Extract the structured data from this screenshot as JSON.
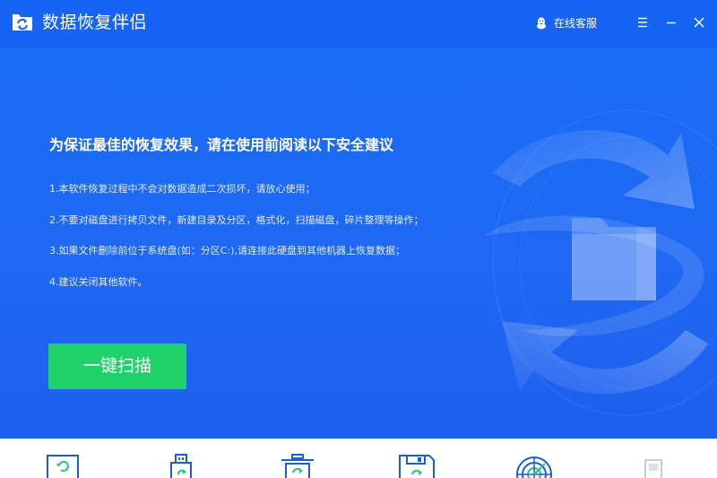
{
  "app": {
    "title": "数据恢复伴侣",
    "logo_icon": "recovery-logo-icon"
  },
  "titlebar": {
    "service_label": "在线客服",
    "service_icon": "qq-penguin-icon",
    "menu_icon": "hamburger-menu-icon",
    "minimize_icon": "minimize-icon",
    "close_icon": "close-icon"
  },
  "main": {
    "headline": "为保证最佳的恢复效果，请在使用前阅读以下安全建议",
    "tips": [
      "1.本软件恢复过程中不会对数据造成二次损坏，请放心使用；",
      "2.不要对磁盘进行拷贝文件，新建目录及分区，格式化，扫描磁盘，碎片整理等操作；",
      "3.如果文件删除前位于系统盘(如：分区C:),请连接此硬盘到其他机器上恢复数据；",
      "4.建议关闭其他软件。"
    ],
    "scan_button": "一键扫描"
  },
  "toolbar": {
    "tools": [
      {
        "icon": "restore-file-icon"
      },
      {
        "icon": "usb-drive-icon"
      },
      {
        "icon": "recycle-bin-icon"
      },
      {
        "icon": "floppy-disk-icon"
      },
      {
        "icon": "disk-scan-icon"
      },
      {
        "icon": "device-icon"
      }
    ]
  },
  "colors": {
    "titlebar": "#1764f4",
    "hero": "#1f68f3",
    "button": "#1fd26a",
    "toolbar_icon": "#1a5fd8",
    "accent_green": "#28c878"
  }
}
